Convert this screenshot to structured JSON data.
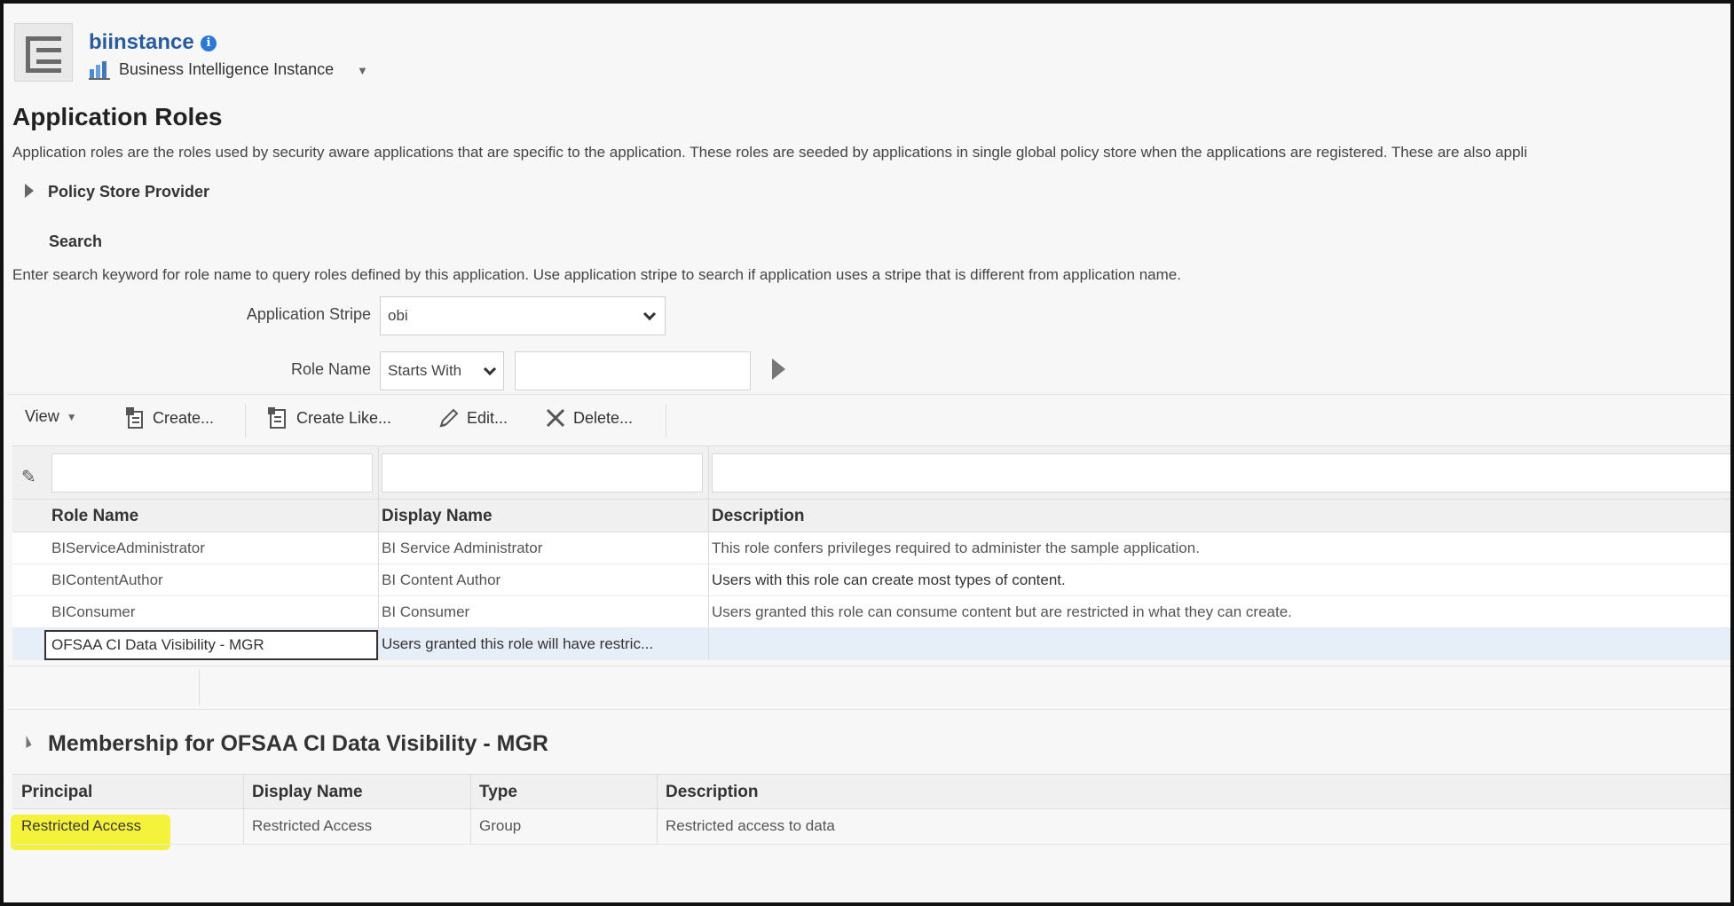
{
  "header": {
    "instance_name": "biinstance",
    "instance_type": "Business Intelligence Instance"
  },
  "page": {
    "title": "Application Roles",
    "description": "Application roles are the roles used by security aware applications that are specific to the application. These roles are seeded by applications in single global policy store when the applications are registered. These are also appli"
  },
  "policy_store": {
    "label": "Policy Store Provider"
  },
  "search": {
    "label": "Search",
    "description": "Enter search keyword for role name to query roles defined by this application. Use application stripe to search if application uses a stripe that is different from application name.",
    "stripe_label": "Application Stripe",
    "stripe_value": "obi",
    "role_label": "Role Name",
    "role_operator": "Starts With",
    "role_value": ""
  },
  "toolbar": {
    "view": "View",
    "create": "Create...",
    "create_like": "Create Like...",
    "edit": "Edit...",
    "delete": "Delete..."
  },
  "roles_table": {
    "columns": [
      "Role Name",
      "Display Name",
      "Description"
    ],
    "rows": [
      {
        "role": "BIServiceAdministrator",
        "display": "BI Service Administrator",
        "desc": "This role confers privileges required to administer the sample application."
      },
      {
        "role": "BIContentAuthor",
        "display": "BI Content Author",
        "desc": "Users with this role can create most types of content."
      },
      {
        "role": "BIConsumer",
        "display": "BI Consumer",
        "desc": "Users granted this role can consume content but are restricted in what they can create."
      },
      {
        "role": "OFSAA CI Data Visibility - MGR",
        "display": "Users granted this role will have restric...",
        "desc": ""
      }
    ]
  },
  "membership": {
    "title": "Membership for OFSAA CI Data Visibility - MGR",
    "columns": [
      "Principal",
      "Display Name",
      "Type",
      "Description"
    ],
    "rows": [
      {
        "principal": "Restricted Access",
        "display": "Restricted Access",
        "type": "Group",
        "desc": "Restricted access to data"
      }
    ]
  },
  "colors": {
    "title_blue": "#2a5b9e",
    "highlight_yellow": "#f4f23a",
    "selected_row": "#e6eef7"
  },
  "icons": [
    "app-menu-icon",
    "info-icon",
    "bi-instance-icon",
    "expand-right-icon",
    "chevron-down-icon",
    "go-arrow-icon",
    "create-icon",
    "create-like-icon",
    "pencil-icon",
    "delete-x-icon",
    "filter-edit-icon",
    "collapse-icon"
  ]
}
